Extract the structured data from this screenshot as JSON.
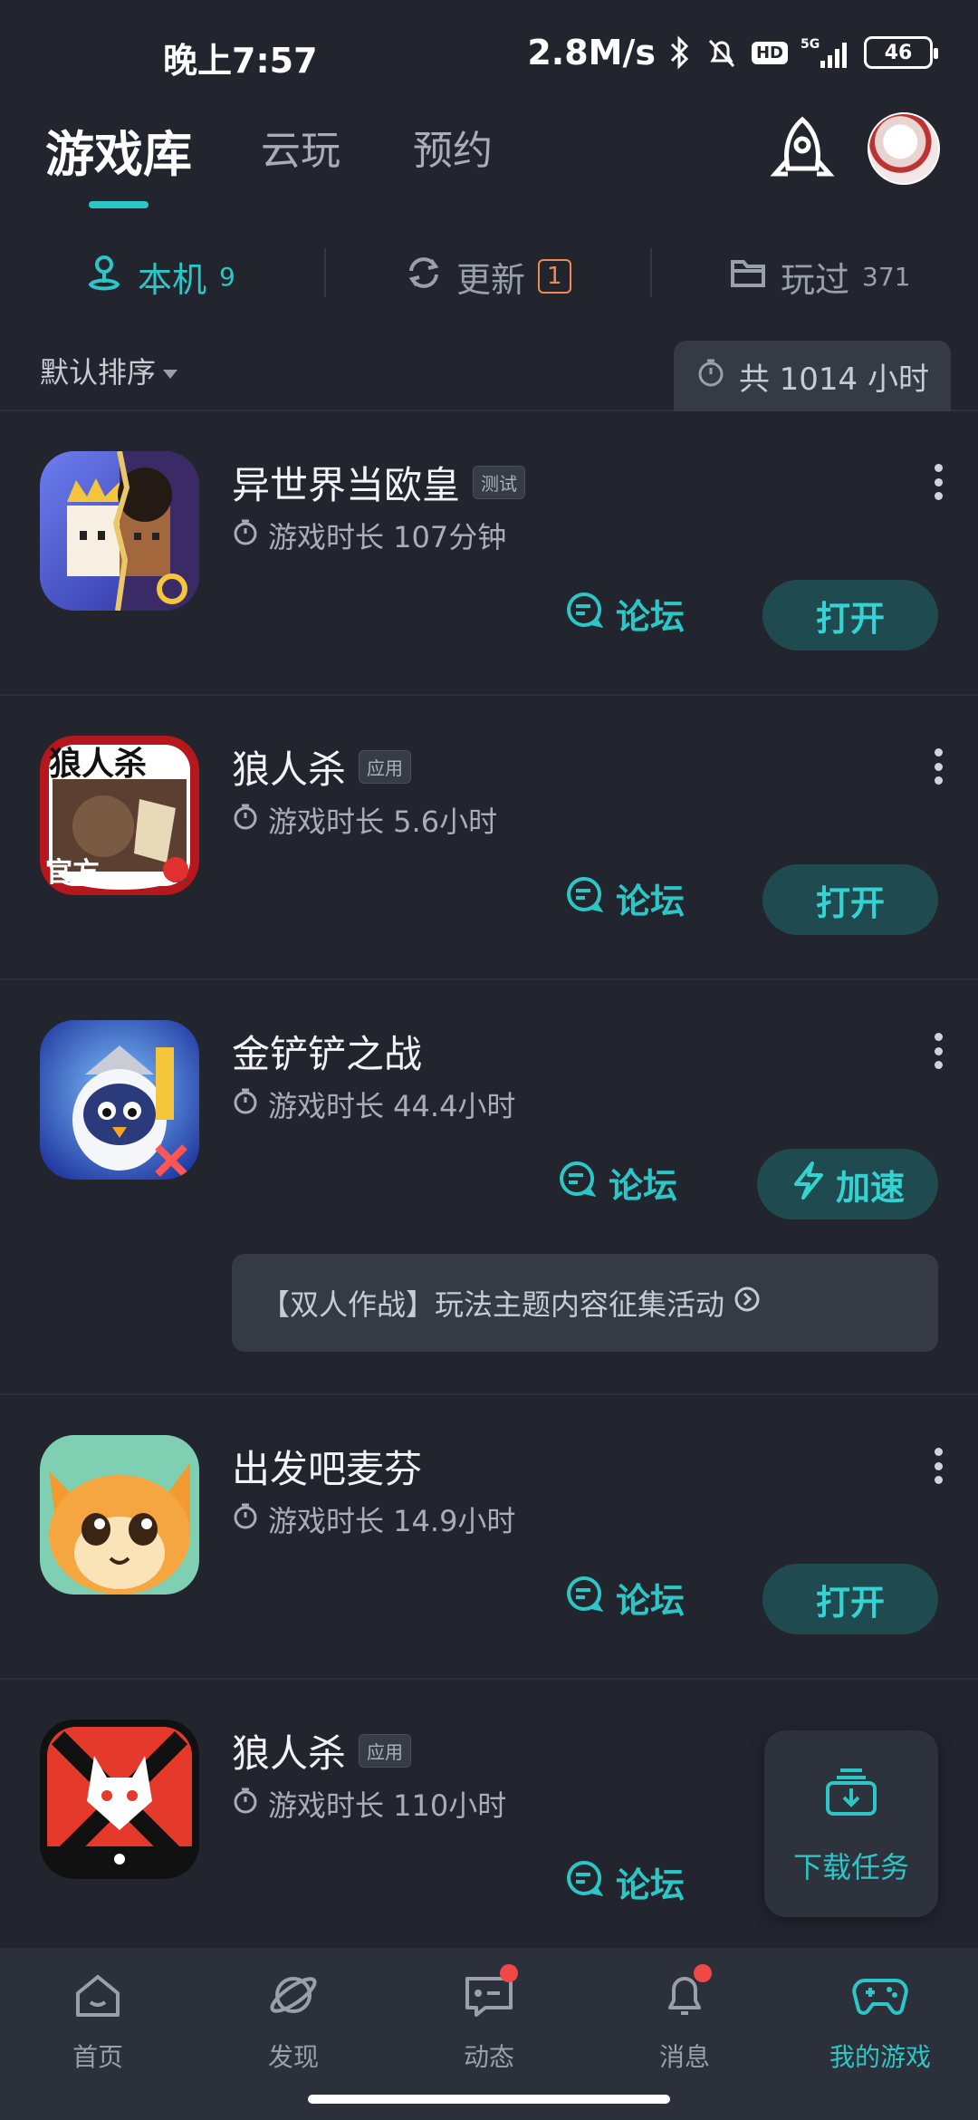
{
  "status_bar": {
    "time": "晚上7:57",
    "speed": "2.8M/s",
    "hd": "HD",
    "network": "5G",
    "battery": "46"
  },
  "header": {
    "tabs": [
      {
        "label": "游戏库",
        "active": true
      },
      {
        "label": "云玩",
        "active": false
      },
      {
        "label": "预约",
        "active": false
      }
    ]
  },
  "subtabs": [
    {
      "label": "本机",
      "count": "9",
      "active": true
    },
    {
      "label": "更新",
      "badge": "1",
      "active": false
    },
    {
      "label": "玩过",
      "count": "371",
      "active": false
    }
  ],
  "sort": {
    "label": "默认排序",
    "total_hours": "共 1014 小时"
  },
  "games": [
    {
      "title": "异世界当欧皇",
      "tag": "测试",
      "time": "游戏时长 107分钟",
      "forum": "论坛",
      "action": "打开"
    },
    {
      "title": "狼人杀",
      "tag": "应用",
      "time": "游戏时长 5.6小时",
      "forum": "论坛",
      "action": "打开"
    },
    {
      "title": "金铲铲之战",
      "tag": "",
      "time": "游戏时长 44.4小时",
      "forum": "论坛",
      "action": "加速",
      "event": "【双人作战】玩法主题内容征集活动"
    },
    {
      "title": "出发吧麦芬",
      "tag": "",
      "time": "游戏时长 14.9小时",
      "forum": "论坛",
      "action": "打开"
    },
    {
      "title": "狼人杀",
      "tag": "应用",
      "time": "游戏时长 110小时",
      "forum": "论坛",
      "action": ""
    }
  ],
  "icon_text": {
    "werewolf_top": "狼人杀",
    "werewolf_bottom": "官方"
  },
  "download_fab": {
    "label": "下载任务"
  },
  "bottom_nav": [
    {
      "label": "首页",
      "icon": "home-icon",
      "dot": false,
      "active": false
    },
    {
      "label": "发现",
      "icon": "planet-icon",
      "dot": false,
      "active": false
    },
    {
      "label": "动态",
      "icon": "chat-icon",
      "dot": true,
      "active": false
    },
    {
      "label": "消息",
      "icon": "bell-icon",
      "dot": true,
      "active": false
    },
    {
      "label": "我的游戏",
      "icon": "gamepad-icon",
      "dot": false,
      "active": true
    }
  ],
  "colors": {
    "accent": "#2cc6c6",
    "background": "#22252e",
    "update_badge": "#f08a53",
    "notification_dot": "#f04747"
  }
}
